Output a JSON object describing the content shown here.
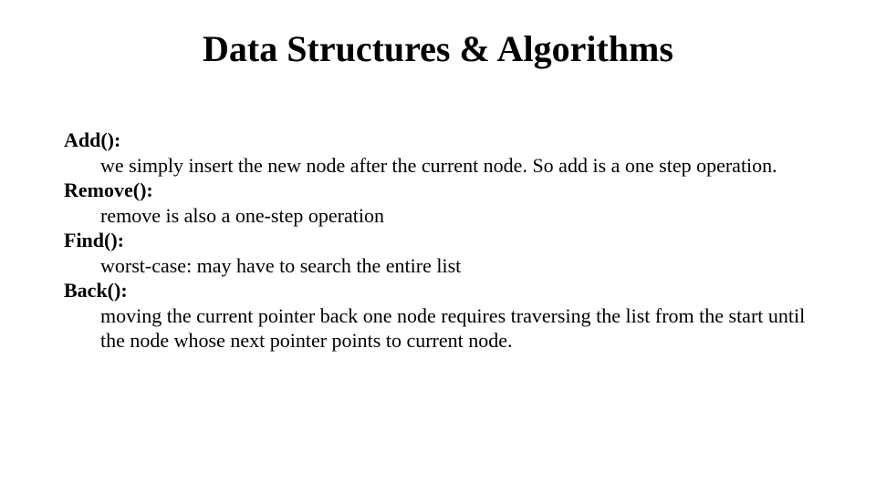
{
  "title": "Data Structures & Algorithms",
  "items": [
    {
      "term": "Add():",
      "desc": "we simply insert the new node after the current node. So add is a one step operation."
    },
    {
      "term": "Remove():",
      "desc": "remove is also a one-step operation"
    },
    {
      "term": "Find():",
      "desc": "worst-case: may have to search the entire list"
    },
    {
      "term": "Back():",
      "desc": "moving the current pointer back one node requires traversing the list from the start until the node whose next pointer points to current node."
    }
  ]
}
